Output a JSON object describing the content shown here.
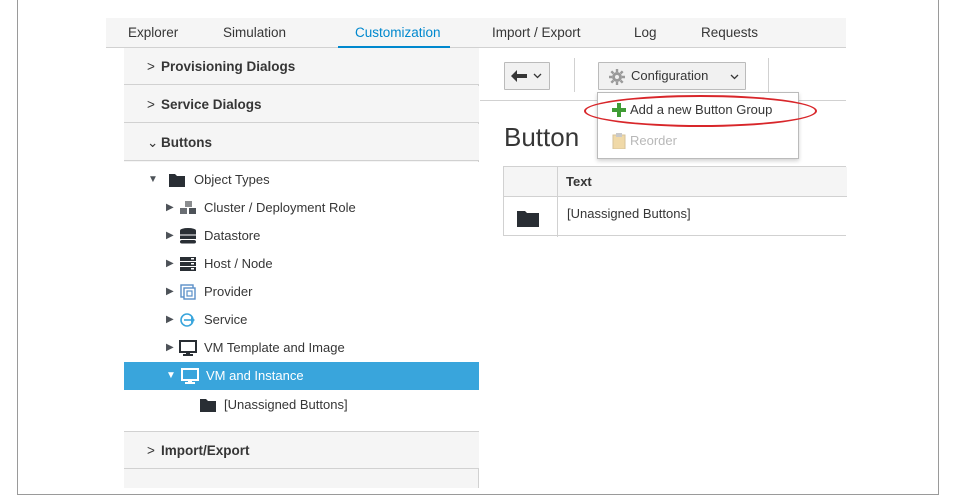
{
  "nav": {
    "tabs": [
      "Explorer",
      "Simulation",
      "Customization",
      "Import / Export",
      "Log",
      "Requests"
    ],
    "active": "Customization"
  },
  "accordion": {
    "provisioning": "Provisioning Dialogs",
    "service": "Service Dialogs",
    "buttons": "Buttons",
    "import_export": "Import/Export"
  },
  "tree": {
    "root": "Object Types",
    "items": [
      "Cluster / Deployment Role",
      "Datastore",
      "Host / Node",
      "Provider",
      "Service",
      "VM Template and Image",
      "VM and Instance"
    ],
    "child": "[Unassigned Buttons]",
    "selected": "VM and Instance"
  },
  "toolbar": {
    "back_icon": "arrow-left-icon",
    "configuration_label": "Configuration",
    "configuration_icon": "gear-icon"
  },
  "dropdown": {
    "add_label": "Add a new Button Group",
    "reorder_label": "Reorder"
  },
  "main": {
    "title": "Button Groups",
    "table": {
      "header": "Text",
      "rows": [
        "[Unassigned Buttons]"
      ]
    }
  },
  "colors": {
    "accent": "#0088ce",
    "selected_row": "#39a5dc",
    "annotation": "#d8262a",
    "add_icon": "#3f9c35"
  }
}
